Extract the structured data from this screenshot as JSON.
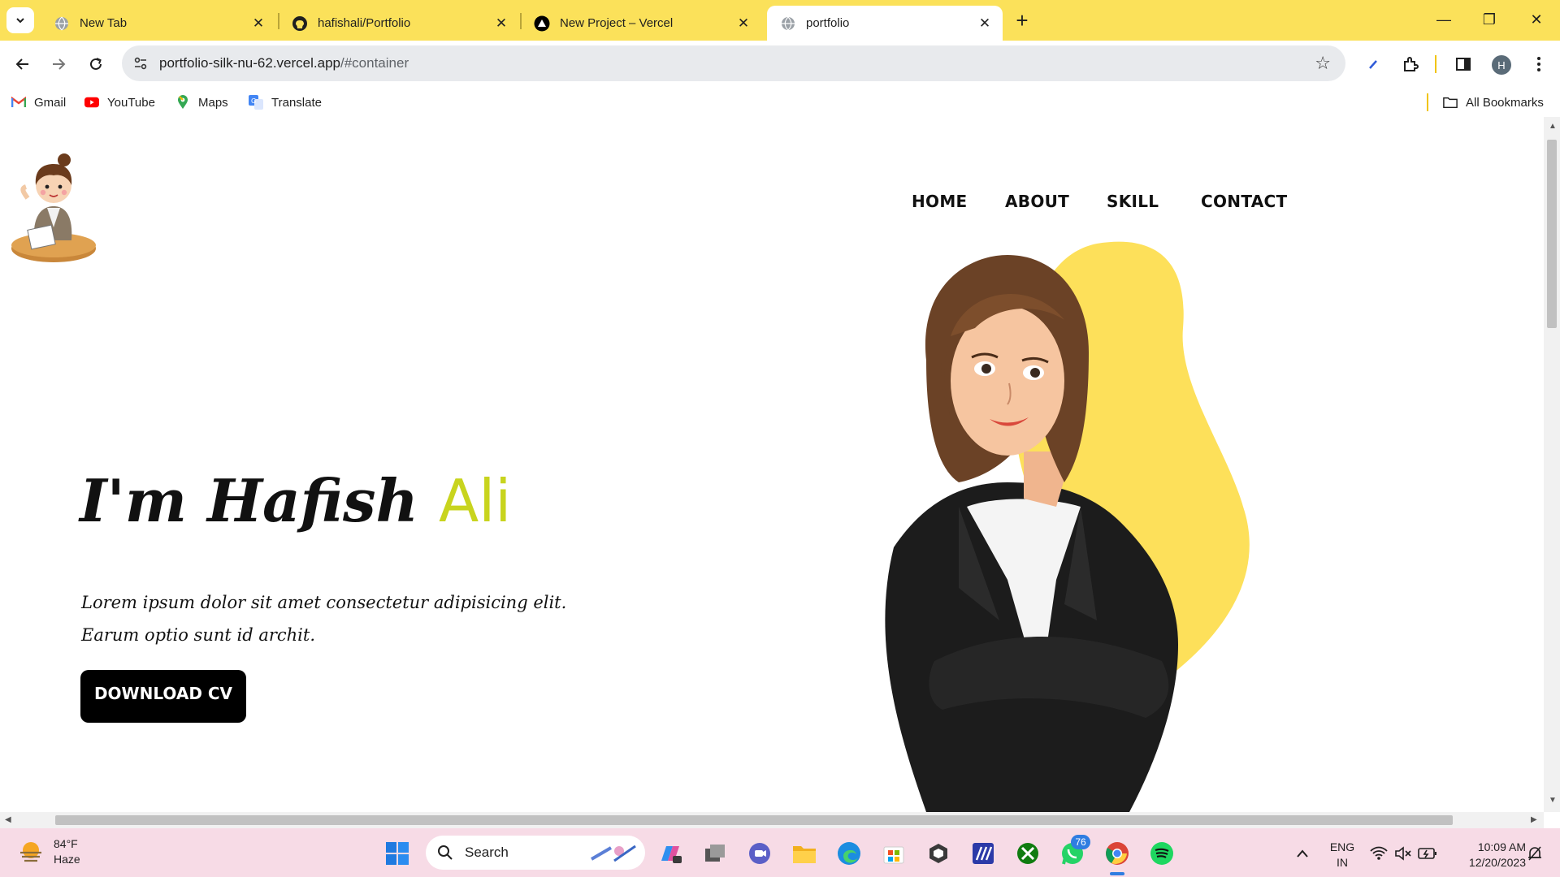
{
  "browser": {
    "tabs": [
      {
        "title": "New Tab",
        "active": false
      },
      {
        "title": "hafishali/Portfolio",
        "active": false
      },
      {
        "title": "New Project – Vercel",
        "active": false
      },
      {
        "title": "portfolio",
        "active": true
      }
    ],
    "tab_close_glyph": "✕",
    "new_tab_glyph": "+",
    "window_controls": {
      "minimize": "—",
      "restore": "❐",
      "close": "✕"
    },
    "url_host": "portfolio-silk-nu-62.vercel.app",
    "url_path": "/#container",
    "profile_initial": "H",
    "bookmarks": [
      "Gmail",
      "YouTube",
      "Maps",
      "Translate"
    ],
    "all_bookmarks_label": "All Bookmarks"
  },
  "site": {
    "nav": [
      "HOME",
      "ABOUT",
      "SKILL",
      "CONTACT"
    ],
    "hero": {
      "greeting": "I'm Hafish",
      "accent_name": "Ali",
      "text_line1": "Lorem ipsum dolor sit amet consectetur adipisicing elit.",
      "text_line2": "Earum optio sunt id archit.",
      "cta": "DOWNLOAD CV"
    },
    "colors": {
      "accent": "#c8d41e",
      "blob": "#fde05a",
      "button": "#000000"
    }
  },
  "taskbar": {
    "weather_temp": "84°F",
    "weather_desc": "Haze",
    "search_label": "Search",
    "whatsapp_badge": "76",
    "lang_line1": "ENG",
    "lang_line2": "IN",
    "time": "10:09 AM",
    "date": "12/20/2023"
  }
}
